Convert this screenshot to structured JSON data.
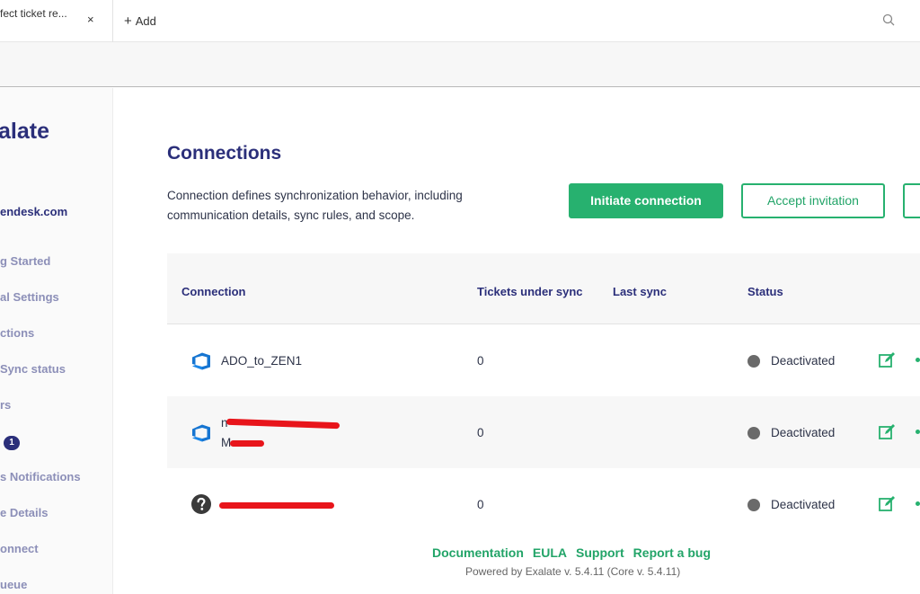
{
  "tabs": {
    "active_label": "fect ticket re...",
    "close_symbol": "×",
    "add_label": "Add"
  },
  "sidebar": {
    "brand": "alate",
    "instance": "endesk.com",
    "items": [
      {
        "label": "g Started"
      },
      {
        "label": "al Settings"
      },
      {
        "label": "ctions"
      },
      {
        "label": "Sync status"
      },
      {
        "label": "rs"
      },
      {
        "label": "",
        "badge": "1"
      },
      {
        "label": "s Notifications"
      },
      {
        "label": "e Details"
      },
      {
        "label": "onnect"
      },
      {
        "label": "ueue"
      }
    ]
  },
  "main": {
    "title": "Connections",
    "description": "Connection defines synchronization behavior, including communication details, sync rules, and scope.",
    "buttons": {
      "initiate": "Initiate connection",
      "accept": "Accept invitation"
    },
    "table": {
      "headers": [
        "Connection",
        "Tickets under sync",
        "Last sync",
        "Status"
      ],
      "rows": [
        {
          "name": "ADO_to_ZEN1",
          "name2": "",
          "icon": "azure-devops-icon",
          "tickets": "0",
          "last_sync": "",
          "status": "Deactivated"
        },
        {
          "name": "n",
          "name2": "M",
          "icon": "azure-devops-icon",
          "tickets": "0",
          "last_sync": "",
          "status": "Deactivated"
        },
        {
          "name": "",
          "name2": "",
          "icon": "question-icon",
          "tickets": "0",
          "last_sync": "",
          "status": "Deactivated"
        }
      ]
    }
  },
  "footer": {
    "links": [
      "Documentation",
      "EULA",
      "Support",
      "Report a bug"
    ],
    "powered": "Powered by Exalate v. 5.4.11 (Core v. 5.4.11)"
  },
  "colors": {
    "accent": "#27b16f",
    "brand": "#2b2f7a",
    "redaction": "#e8151b"
  }
}
